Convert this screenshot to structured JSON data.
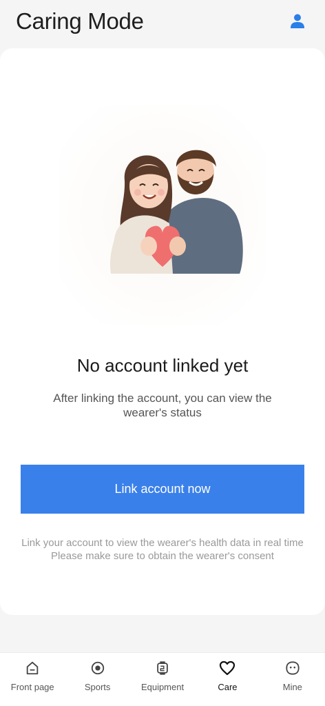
{
  "header": {
    "title": "Caring Mode",
    "profile_icon": "person-icon",
    "accent_color": "#2a7fe8"
  },
  "empty_state": {
    "illustration": "couple-holding-heart-illustration",
    "heading": "No account linked yet",
    "description": "After linking the account, you can view the wearer's status",
    "button_label": "Link account now",
    "button_color": "#3a80ea",
    "note_line1": "Link your account to view the wearer's health data in real time",
    "note_line2": "Please make sure to obtain the wearer's consent"
  },
  "tabbar": {
    "active": "Care",
    "items": [
      {
        "label": "Front page",
        "icon": "home-icon"
      },
      {
        "label": "Sports",
        "icon": "target-icon"
      },
      {
        "label": "Equipment",
        "icon": "watch-icon"
      },
      {
        "label": "Care",
        "icon": "heart-icon"
      },
      {
        "label": "Mine",
        "icon": "smile-face-icon"
      }
    ]
  }
}
